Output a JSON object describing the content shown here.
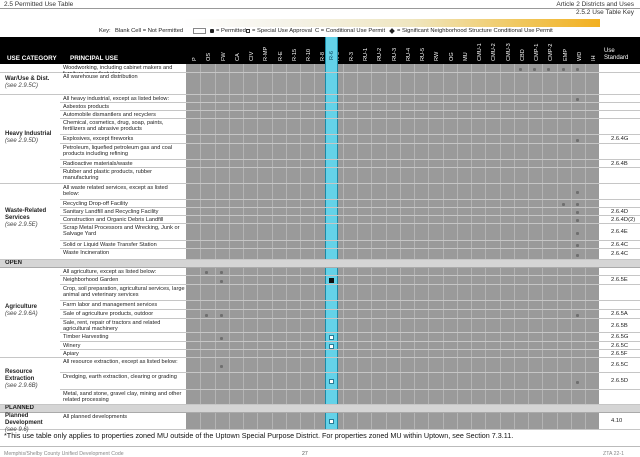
{
  "header": {
    "left_title": "2.5 Permitted Use Table",
    "right_title": "Article 2 Districts and Uses",
    "right_subtitle": "2.5.2 Use Table Key"
  },
  "key": {
    "label": "Key:",
    "blank": "Blank Cell = Not Permitted",
    "permitted": "= Permitted",
    "special": "= Special Use Approval",
    "conditional": "C = Conditional Use Permit",
    "significant": "= Significant Neighborhood Structure Conditional Use Permit"
  },
  "table_header": {
    "use_category": "USE CATEGORY",
    "principal_use": "PRINCIPAL USE",
    "use_standard": "Use Standard",
    "zones": [
      "P",
      "OS",
      "FW",
      "CA",
      "CIV",
      "R-MP",
      "R-E",
      "R-15",
      "R-10",
      "R-8",
      "R-6",
      "R-3",
      "RU-1",
      "RU-2",
      "RU-3",
      "RU-4",
      "RU-5",
      "RW",
      "OG",
      "MU",
      "CMU-1",
      "CMU-2",
      "CMU-3",
      "CBD",
      "CMP-1",
      "CMP-2",
      "EMP",
      "WD",
      "IH"
    ],
    "highlight_zone": "R-6"
  },
  "categories": [
    {
      "name": "War/Use & Dist.",
      "ref": "(see 2.9.5C)"
    },
    {
      "name": "Heavy Industrial",
      "ref": "(see 2.9.5D)"
    },
    {
      "name": "Waste-Related Services",
      "ref": "(see 2.9.5E)"
    },
    {
      "name": "Agriculture",
      "ref": "(see 2.9.6A)"
    },
    {
      "name": "Resource Extraction",
      "ref": "(see 2.9.6B)"
    },
    {
      "name": "Planned Development",
      "ref": "(see 9.6)"
    }
  ],
  "sections": {
    "open": "OPEN",
    "planned": "PLANNED"
  },
  "rows": [
    {
      "use": "Woodworking, including cabinet makers and furniture manufacturing",
      "std": ""
    },
    {
      "use": "All warehouse and distribution",
      "std": ""
    },
    {
      "use": "All heavy industrial, except as listed below:",
      "std": ""
    },
    {
      "use": "Asbestos products",
      "std": ""
    },
    {
      "use": "Automobile dismantlers and recyclers",
      "std": ""
    },
    {
      "use": "Chemical, cosmetics, drug, soap, paints, fertilizers and abrasive products",
      "std": ""
    },
    {
      "use": "Explosives, except fireworks",
      "std": "2.6.4G"
    },
    {
      "use": "Petroleum, liquefied petroleum gas and coal products including refining",
      "std": ""
    },
    {
      "use": "Radioactive materials/waste",
      "std": "2.6.4B"
    },
    {
      "use": "Rubber and plastic products, rubber manufacturing",
      "std": ""
    },
    {
      "use": "All waste related services, except as listed below:",
      "std": ""
    },
    {
      "use": "Recycling Drop-off Facility",
      "std": ""
    },
    {
      "use": "Sanitary Landfill and Recycling Facility",
      "std": "2.6.4D"
    },
    {
      "use": "Construction and Organic Debris Landfill",
      "std": "2.6.4D(2)"
    },
    {
      "use": "Scrap Metal Processors and Wrecking, Junk or Salvage Yard",
      "std": "2.6.4E"
    },
    {
      "use": "Solid or Liquid Waste Transfer Station",
      "std": "2.6.4C"
    },
    {
      "use": "Waste Incineration",
      "std": "2.6.4C"
    },
    {
      "use": "All agriculture, except as listed below:",
      "std": ""
    },
    {
      "use": "Neighborhood Garden",
      "std": "2.6.5E"
    },
    {
      "use": "Crop, soil preparation, agricultural services, large animal and veterinary services",
      "std": ""
    },
    {
      "use": "Farm labor and management services",
      "std": ""
    },
    {
      "use": "Sale of agriculture products, outdoor",
      "std": "2.6.5A"
    },
    {
      "use": "Sale, rent, repair of tractors and related agricultural machinery",
      "std": "2.6.5B"
    },
    {
      "use": "Timber Harvesting",
      "std": "2.6.5G"
    },
    {
      "use": "Winery",
      "std": "2.6.5C"
    },
    {
      "use": "Apiary",
      "std": "2.6.5F"
    },
    {
      "use": "All resource extraction, except as listed below:",
      "std": "2.6.5C"
    },
    {
      "use": "Dredging, earth extraction, clearing or grading",
      "std": "2.6.5D"
    },
    {
      "use": "Metal, sand stone, gravel clay, mining and other related processing",
      "std": ""
    },
    {
      "use": "All planned developments",
      "std": "4.10"
    }
  ],
  "footnote": "*This use table only applies to properties zoned MU outside of the Uptown Special Purpose District. For properties zoned MU within Uptown, see Section 7.3.11.",
  "footer": {
    "left": "Memphis/Shelby County Unified Development Code",
    "page": "27",
    "right": "ZTA 22-1"
  }
}
